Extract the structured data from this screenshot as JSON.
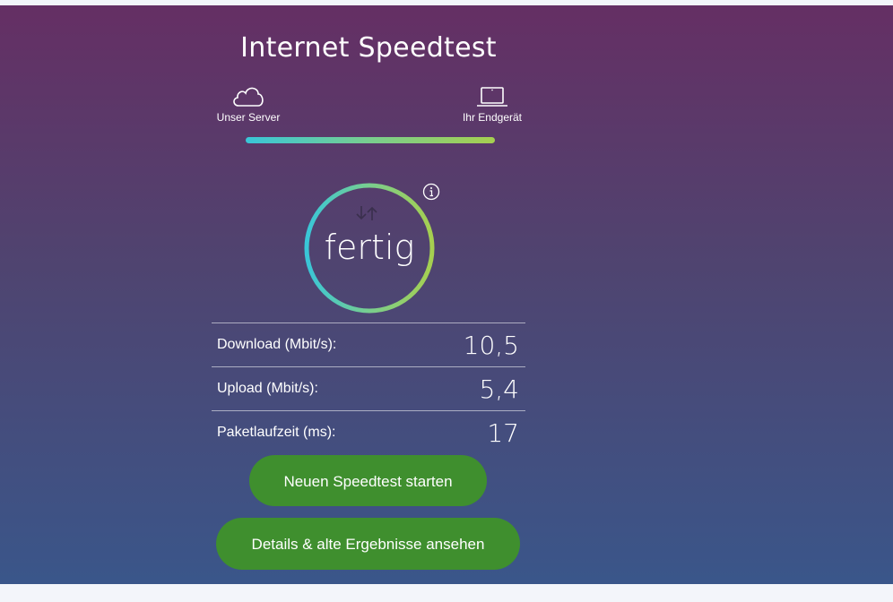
{
  "header": {
    "title": "Internet Speedtest"
  },
  "route": {
    "server_label": "Unser Server",
    "server_icon": "cloud-icon",
    "device_label": "Ihr Endgerät",
    "device_icon": "laptop-icon",
    "progress": 1.0
  },
  "gauge": {
    "status": "fertig",
    "icon": "up-down-arrows-icon",
    "info_icon": "info-icon"
  },
  "results": [
    {
      "label": "Download (Mbit/s):",
      "value": "10,5"
    },
    {
      "label": "Upload (Mbit/s):",
      "value": "5,4"
    },
    {
      "label": "Paketlaufzeit (ms):",
      "value": "17"
    }
  ],
  "actions": {
    "new_test": "Neuen Speedtest starten",
    "details": "Details & alte Ergebnisse ansehen"
  },
  "colors": {
    "gradient_top": "#652f64",
    "gradient_bottom": "#3a568a",
    "accent_cyan": "#39c6d8",
    "accent_green": "#a6cf50",
    "button_green": "#3f8f2e"
  }
}
